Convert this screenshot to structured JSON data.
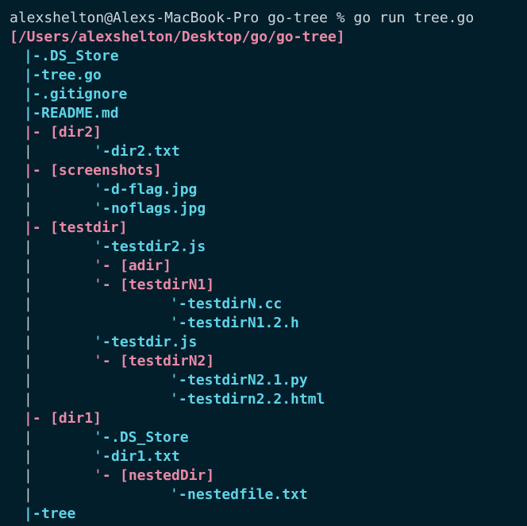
{
  "colors": {
    "background": "#031e2b",
    "prompt": "#cfd8dc",
    "file": "#5fd3e7",
    "dir": "#e98aa6",
    "guide": "#c9d1d5"
  },
  "terminal": {
    "prompt": "alexshelton@Alexs-MacBook-Pro go-tree % go run tree.go",
    "root": "[/Users/alexshelton/Desktop/go/go-tree]",
    "entries": [
      {
        "level": 1,
        "branch": "|-",
        "name": ".DS_Store",
        "kind": "file"
      },
      {
        "level": 1,
        "branch": "|-",
        "name": "tree.go",
        "kind": "file"
      },
      {
        "level": 1,
        "branch": "|-",
        "name": ".gitignore",
        "kind": "file"
      },
      {
        "level": 1,
        "branch": "|-",
        "name": "README.md",
        "kind": "file"
      },
      {
        "level": 1,
        "branch": "|- ",
        "name": "[dir2]",
        "kind": "dir"
      },
      {
        "level": 2,
        "branch": "ˈ-",
        "name": "dir2.txt",
        "kind": "file"
      },
      {
        "level": 1,
        "branch": "|- ",
        "name": "[screenshots]",
        "kind": "dir"
      },
      {
        "level": 2,
        "branch": "ˈ-",
        "name": "d-flag.jpg",
        "kind": "file"
      },
      {
        "level": 2,
        "branch": "ˈ-",
        "name": "noflags.jpg",
        "kind": "file"
      },
      {
        "level": 1,
        "branch": "|- ",
        "name": "[testdir]",
        "kind": "dir"
      },
      {
        "level": 2,
        "branch": "ˈ-",
        "name": "testdir2.js",
        "kind": "file"
      },
      {
        "level": 2,
        "branch": "ˈ- ",
        "name": "[adir]",
        "kind": "dir"
      },
      {
        "level": 2,
        "branch": "ˈ- ",
        "name": "[testdirN1]",
        "kind": "dir"
      },
      {
        "level": 3,
        "branch": "ˈ-",
        "name": "testdirN.cc",
        "kind": "file"
      },
      {
        "level": 3,
        "branch": "ˈ-",
        "name": "testdirN1.2.h",
        "kind": "file"
      },
      {
        "level": 2,
        "branch": "ˈ-",
        "name": "testdir.js",
        "kind": "file"
      },
      {
        "level": 2,
        "branch": "ˈ- ",
        "name": "[testdirN2]",
        "kind": "dir"
      },
      {
        "level": 3,
        "branch": "ˈ-",
        "name": "testdirN2.1.py",
        "kind": "file"
      },
      {
        "level": 3,
        "branch": "ˈ-",
        "name": "testdirn2.2.html",
        "kind": "file"
      },
      {
        "level": 1,
        "branch": "|- ",
        "name": "[dir1]",
        "kind": "dir"
      },
      {
        "level": 2,
        "branch": "ˈ-",
        "name": ".DS_Store",
        "kind": "file"
      },
      {
        "level": 2,
        "branch": "ˈ-",
        "name": "dir1.txt",
        "kind": "file"
      },
      {
        "level": 2,
        "branch": "ˈ- ",
        "name": "[nestedDir]",
        "kind": "dir"
      },
      {
        "level": 3,
        "branch": "ˈ-",
        "name": "nestedfile.txt",
        "kind": "file"
      },
      {
        "level": 1,
        "branch": "|-",
        "name": "tree",
        "kind": "file"
      }
    ]
  }
}
